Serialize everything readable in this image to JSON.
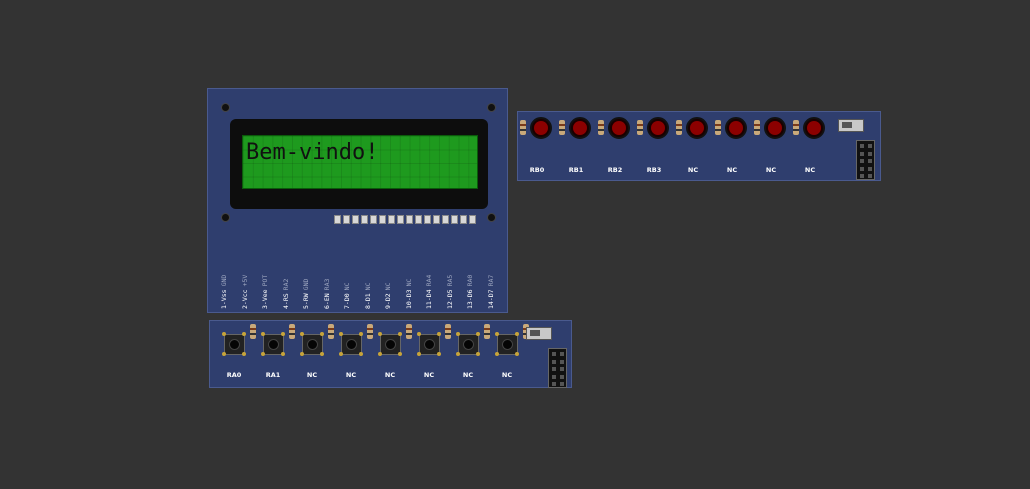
{
  "lcd": {
    "text": "Bem-vindo!",
    "pins": [
      {
        "main": "1-Vss",
        "sub": "GND"
      },
      {
        "main": "2-Vcc",
        "sub": "+5V"
      },
      {
        "main": "3-Vee",
        "sub": "POT"
      },
      {
        "main": "4-RS",
        "sub": "RA2"
      },
      {
        "main": "5-RW",
        "sub": "GND"
      },
      {
        "main": "6-EN",
        "sub": "RA3"
      },
      {
        "main": "7-D0",
        "sub": "NC"
      },
      {
        "main": "8-D1",
        "sub": "NC"
      },
      {
        "main": "9-D2",
        "sub": "NC"
      },
      {
        "main": "10-D3",
        "sub": "NC"
      },
      {
        "main": "11-D4",
        "sub": "RA4"
      },
      {
        "main": "12-D5",
        "sub": "RA5"
      },
      {
        "main": "13-D6",
        "sub": "RA0"
      },
      {
        "main": "14-D7",
        "sub": "RA7"
      }
    ]
  },
  "leds": {
    "labels": [
      "RB0",
      "RB1",
      "RB2",
      "RB3",
      "NC",
      "NC",
      "NC",
      "NC"
    ],
    "color": "#8c0000"
  },
  "buttons": {
    "labels": [
      "RA0",
      "RA1",
      "NC",
      "NC",
      "NC",
      "NC",
      "NC",
      "NC"
    ]
  },
  "colors": {
    "background": "#333333",
    "board": "#2f3e6e",
    "lcd_screen": "#1e9a1e"
  }
}
